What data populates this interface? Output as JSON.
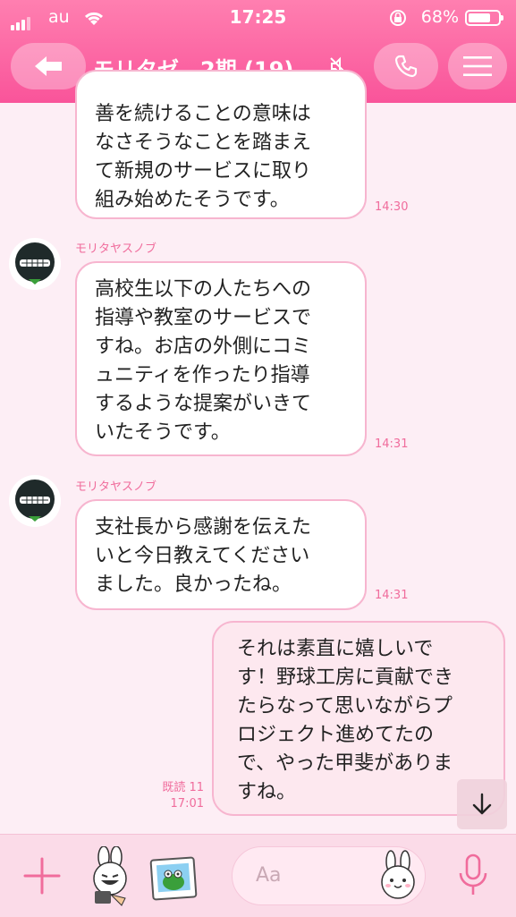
{
  "status": {
    "carrier": "au",
    "time": "17:25",
    "battery": "68%"
  },
  "header": {
    "title": "モリタゼ…2期 (19)"
  },
  "messages": [
    {
      "text": "善を続けることの意味は\nなさそうなことを踏まえ\nて新規のサービスに取り\n組み始めたそうです。",
      "time": "14:30"
    },
    {
      "sender": "モリタヤスノブ",
      "text": "高校生以下の人たちへの\n指導や教室のサービスで\nすね。お店の外側にコミ\nュニティを作ったり指導\nするような提案がいきて\nいたそうです。",
      "time": "14:31"
    },
    {
      "sender": "モリタヤスノブ",
      "text": "支社長から感謝を伝えた\nいと今日教えてください\nました。良かったね。",
      "time": "14:31"
    },
    {
      "text": "それは素直に嬉しいで\nす！野球工房に貢献でき\nたらなって思いながらプ\nロジェクト進めてたの\nで、やった甲斐がありま\nすね。",
      "read": "既読 11",
      "time": "17:01"
    }
  ],
  "input": {
    "placeholder": "Aa"
  },
  "colors": {
    "header": "#f9549a",
    "accent": "#f06c9c",
    "background": "#fdeef5"
  }
}
